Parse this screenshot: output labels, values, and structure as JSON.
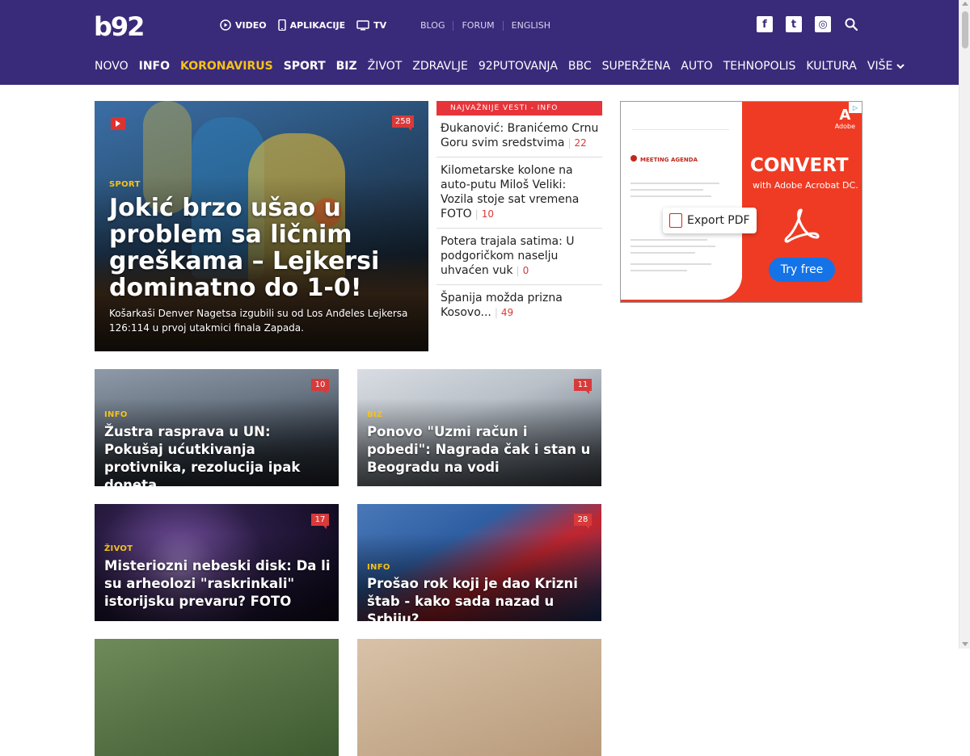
{
  "header": {
    "logo": "b92",
    "top_links": [
      {
        "label": "VIDEO",
        "icon": "play-circle-icon"
      },
      {
        "label": "APLIKACIJE",
        "icon": "phone-icon"
      },
      {
        "label": "TV",
        "icon": "tv-icon"
      }
    ],
    "sub_links": [
      "BLOG",
      "FORUM",
      "ENGLISH"
    ],
    "social": [
      {
        "name": "facebook-icon",
        "glyph": "f"
      },
      {
        "name": "twitter-icon",
        "glyph": "t"
      },
      {
        "name": "instagram-icon",
        "glyph": "◎"
      }
    ],
    "nav": [
      {
        "label": "NOVO",
        "style": "normal"
      },
      {
        "label": "INFO",
        "style": "bold"
      },
      {
        "label": "KORONAVIRUS",
        "style": "yellow"
      },
      {
        "label": "SPORT",
        "style": "bold"
      },
      {
        "label": "BIZ",
        "style": "bold"
      },
      {
        "label": "ŽIVOT",
        "style": "normal"
      },
      {
        "label": "ZDRAVLJE",
        "style": "normal"
      },
      {
        "label": "92PUTOVANJA",
        "style": "normal"
      },
      {
        "label": "BBC",
        "style": "normal"
      },
      {
        "label": "SUPERŽENA",
        "style": "normal"
      },
      {
        "label": "AUTO",
        "style": "normal"
      },
      {
        "label": "TEHNOPOLIS",
        "style": "normal"
      },
      {
        "label": "KULTURA",
        "style": "normal"
      },
      {
        "label": "VIŠE",
        "style": "normal"
      }
    ],
    "colors": {
      "bg": "#3a2a7a",
      "accent": "#f4c21a"
    }
  },
  "hero": {
    "category": "SPORT",
    "comments": "258",
    "title": "Jokić brzo ušao u problem sa ličnim greškama – Lejkersi dominatno do 1-0!",
    "lead": "Košarkaši Denver Nagetsa izgubili su od Los Anđeles Lejkersa 126:114 u prvoj utakmici finala Zapada."
  },
  "top_news": {
    "heading": "NAJVAŽNIJE VESTI - INFO",
    "items": [
      {
        "title": "Đukanović: Branićemo Crnu Goru svim sredstvima",
        "count": "22"
      },
      {
        "title": "Kilometarske kolone na auto-putu Miloš Veliki: Vozila stoje sat vremena FOTO",
        "count": "10"
      },
      {
        "title": "Potera trajala satima: U podgoričkom naselju uhvaćen vuk",
        "count": "0"
      },
      {
        "title": "Španija možda prizna Kosovo...",
        "count": "49"
      }
    ]
  },
  "ad": {
    "brand": "Adobe",
    "headline": "CONVERT",
    "subline": "with Adobe Acrobat DC.",
    "export_label": "Export PDF",
    "cta": "Try free",
    "doc_title": "MEETING AGENDA"
  },
  "cards": [
    {
      "category": "INFO",
      "comments": "10",
      "title": "Žustra rasprava u UN: Pokušaj ućutkivanja protivnika, rezolucija ipak doneta"
    },
    {
      "category": "BIZ",
      "comments": "11",
      "title": "Ponovo \"Uzmi račun i pobedi\": Nagrada čak i stan u Beogradu na vodi"
    },
    {
      "category": "ŽIVOT",
      "comments": "17",
      "title": "Misteriozni nebeski disk: Da li su arheolozi \"raskrinkali\" istorijsku prevaru? FOTO"
    },
    {
      "category": "INFO",
      "comments": "28",
      "title": "Prošao rok koji je dao Krizni štab - kako sada nazad u Srbiju?"
    }
  ]
}
